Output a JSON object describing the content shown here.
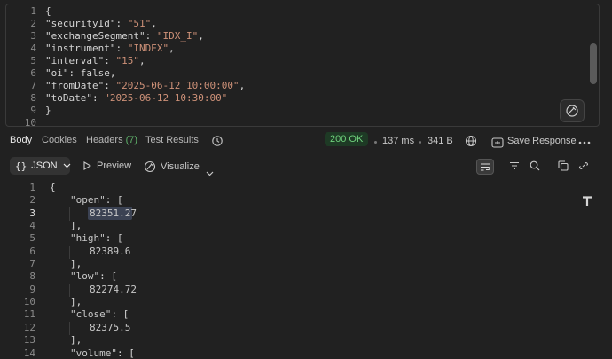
{
  "request_body": {
    "line_numbers": [
      "1",
      "2",
      "3",
      "4",
      "5",
      "6",
      "7",
      "8",
      "9",
      "10"
    ],
    "lines": [
      {
        "text": "{"
      },
      {
        "key": "\"securityId\"",
        "sep": ": ",
        "value": "\"51\"",
        "end": ","
      },
      {
        "key": "\"exchangeSegment\"",
        "sep": ": ",
        "value": "\"IDX_I\"",
        "end": ","
      },
      {
        "key": "\"instrument\"",
        "sep": ": ",
        "value": "\"INDEX\"",
        "end": ","
      },
      {
        "key": "\"interval\"",
        "sep": ": ",
        "value": "\"15\"",
        "end": ","
      },
      {
        "key": "\"oi\"",
        "sep": ": ",
        "literal": "false",
        "end": ","
      },
      {
        "key": "\"fromDate\"",
        "sep": ": ",
        "value": "\"2025-06-12 10:00:00\"",
        "end": ","
      },
      {
        "key": "\"toDate\"",
        "sep": ": ",
        "value": "\"2025-06-12 10:30:00\""
      },
      {
        "text": "}"
      },
      {
        "text": ""
      }
    ],
    "beautify_icon": "beautify-icon"
  },
  "response_tabs": {
    "body": "Body",
    "cookies": "Cookies",
    "headers": "Headers",
    "headers_count": "(7)",
    "test_results": "Test Results",
    "history_icon": "history-icon"
  },
  "response_meta": {
    "status": "200 OK",
    "time": "137 ms",
    "size": "341 B",
    "globe_icon": "globe-icon",
    "save_response": "Save Response",
    "more_icon": "more-icon",
    "status_color": "#6fd07c"
  },
  "toolbar": {
    "format": "JSON",
    "preview": "Preview",
    "visualize": "Visualize"
  },
  "response_body": {
    "line_numbers": [
      "1",
      "2",
      "3",
      "4",
      "5",
      "6",
      "7",
      "8",
      "9",
      "10",
      "11",
      "12",
      "13",
      "14"
    ],
    "lines": [
      {
        "text": "{"
      },
      {
        "key": "\"open\"",
        "rest": ": ["
      },
      {
        "num": "82351.27"
      },
      {
        "text": "],"
      },
      {
        "key": "\"high\"",
        "rest": ": ["
      },
      {
        "num": "82389.6"
      },
      {
        "text": "],"
      },
      {
        "key": "\"low\"",
        "rest": ": ["
      },
      {
        "num": "82274.72"
      },
      {
        "text": "],"
      },
      {
        "key": "\"close\"",
        "rest": ": ["
      },
      {
        "num": "82375.5"
      },
      {
        "text": "],"
      },
      {
        "key": "\"volume\"",
        "rest": ": ["
      }
    ]
  }
}
